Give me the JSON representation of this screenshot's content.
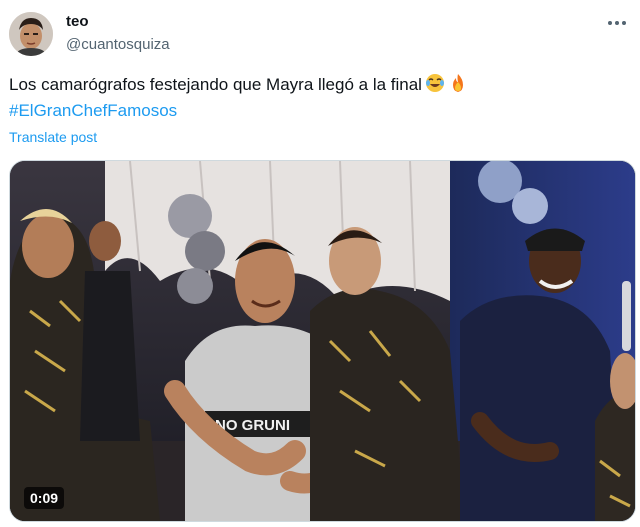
{
  "post": {
    "author": {
      "display_name": "teo",
      "handle": "@cuantosquiza"
    },
    "text": "Los camarógrafos festejando que Mayra llegó a la final",
    "emojis": [
      "face-with-tears-of-joy-emoji",
      "fire-emoji"
    ],
    "hashtag": "#ElGranChefFamosos",
    "translate_label": "Translate post",
    "more_icon": "more-horizontal-icon",
    "video": {
      "duration": "0:09"
    }
  },
  "colors": {
    "accent": "#1d9bf0",
    "secondary_text": "#536471",
    "primary_text": "#0f1419",
    "border": "#cfd9de"
  }
}
